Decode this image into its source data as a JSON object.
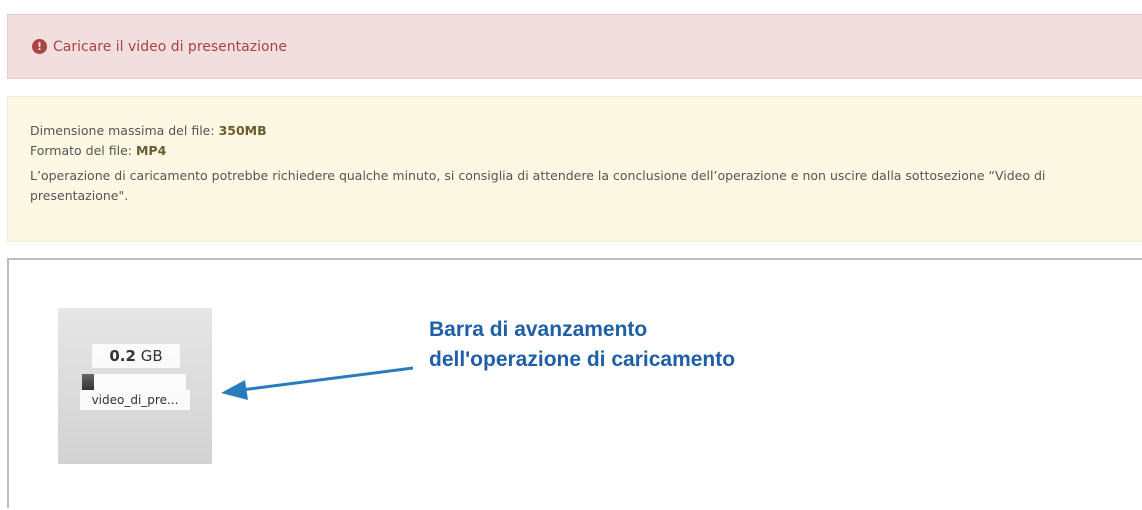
{
  "error_alert": {
    "icon": "exclamation-circle-icon",
    "message": "Caricare il video di presentazione",
    "color": "#a94442"
  },
  "info_alert": {
    "max_size_label": "Dimensione massima del file:",
    "max_size_value": "350MB",
    "format_label": "Formato del file:",
    "format_value": "MP4",
    "note": "L’operazione di caricamento potrebbe richiedere qualche minuto, si consiglia di attendere la conclusione dell’operazione e non uscire dalla sottosezione “Video di presentazione\"."
  },
  "upload": {
    "size_value": "0.2",
    "size_unit": "GB",
    "progress_fraction": 0.12,
    "filename": "video_di_pre..."
  },
  "annotation": {
    "text": "Barra di avanzamento dell'operazione di caricamento",
    "color": "#1f5fa8"
  }
}
